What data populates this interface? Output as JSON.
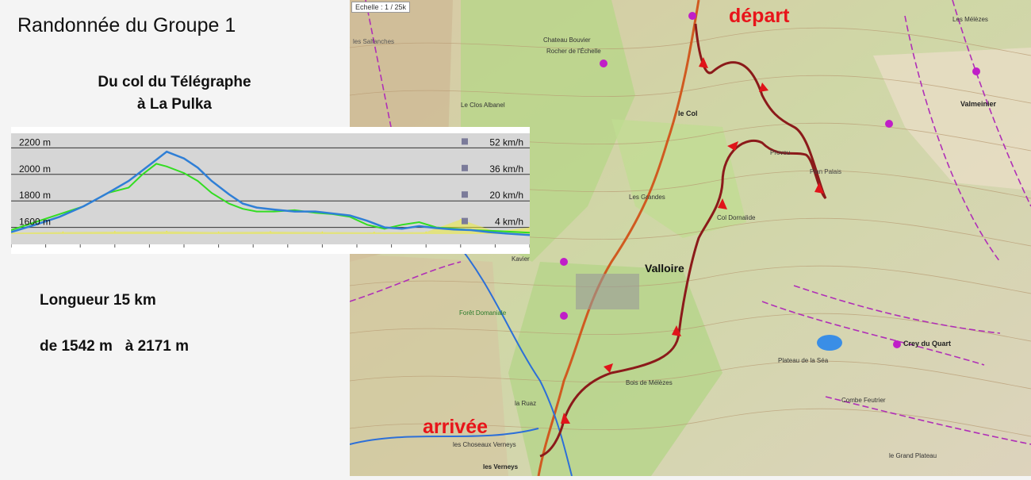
{
  "left_panel": {
    "title": "Randonnée du Groupe 1",
    "subtitle_line1": "Du col du Télégraphe",
    "subtitle_line2": "à La Pulka",
    "length": "Longueur 15 km",
    "altitude_range": "de 1542 m   à 2171 m"
  },
  "map": {
    "scale_label": "Echelle : 1 / 25k",
    "start_label": "départ",
    "end_label": "arrivée",
    "place_names": [
      "Valloire",
      "le Col",
      "Valmeinier",
      "Crey du Quart",
      "Plan Palais",
      "Provou",
      "Les Grandes",
      "Col Dornalide",
      "Bois de Mélèzes",
      "la Ruaz",
      "les Verneys",
      "les Choseaux Verneys",
      "Combe Feutrier",
      "Plateau de la Séa",
      "le Grand Plateau",
      "Les Mélèzes",
      "Forêt Domaniale",
      "Chateau Bouvier",
      "Rocher de l'Échelle",
      "les Salfanches",
      "Kavier",
      "Le Clos Albanel"
    ]
  },
  "chart_data": {
    "type": "area",
    "title": "",
    "x_unit": "km",
    "y_axis_left": {
      "label": "",
      "ticks": [
        "1600 m",
        "1800 m",
        "2000 m",
        "2200 m"
      ],
      "range": [
        1550,
        2250
      ]
    },
    "y_axis_right": {
      "label": "",
      "ticks": [
        "4 km/h",
        "20 km/h",
        "36 km/h",
        "52 km/h"
      ]
    },
    "grid": true,
    "x_range": [
      0,
      15
    ],
    "series": [
      {
        "color": "#2f7fd6",
        "x": [
          0,
          0.7,
          1.4,
          2.1,
          2.8,
          3.4,
          3.8,
          4.2,
          4.5,
          5.0,
          5.4,
          5.8,
          6.3,
          6.7,
          7.1,
          7.6,
          8.2,
          8.8,
          9.3,
          9.8,
          10.3,
          10.8,
          11.3,
          11.8,
          12.3,
          12.8,
          13.3,
          13.8,
          14.3,
          15.0
        ],
        "y": [
          1565,
          1620,
          1680,
          1760,
          1860,
          1950,
          2030,
          2110,
          2171,
          2120,
          2050,
          1950,
          1850,
          1780,
          1750,
          1735,
          1720,
          1720,
          1705,
          1690,
          1650,
          1600,
          1590,
          1610,
          1595,
          1585,
          1580,
          1565,
          1555,
          1542
        ]
      },
      {
        "color": "#33dd22",
        "x": [
          0,
          0.7,
          1.4,
          2.1,
          2.8,
          3.4,
          3.8,
          4.2,
          4.5,
          5.0,
          5.4,
          5.8,
          6.3,
          6.7,
          7.1,
          7.6,
          8.2,
          8.8,
          9.3,
          9.8,
          10.3,
          10.8,
          11.3,
          11.8,
          12.3,
          12.8,
          13.3,
          13.8,
          14.3,
          15.0
        ],
        "y": [
          1580,
          1640,
          1700,
          1760,
          1860,
          1900,
          2000,
          2080,
          2060,
          2010,
          1950,
          1860,
          1780,
          1740,
          1720,
          1720,
          1730,
          1710,
          1700,
          1680,
          1620,
          1590,
          1620,
          1640,
          1600,
          1590,
          1580,
          1575,
          1570,
          1560
        ]
      },
      {
        "color": "#ecec3a",
        "x": [
          0,
          1.5,
          3.0,
          4.5,
          6.0,
          7.5,
          9.0,
          10.5,
          12.0,
          13.0,
          14.0,
          15.0
        ],
        "y": [
          1560,
          1565,
          1568,
          1570,
          1565,
          1568,
          1565,
          1563,
          1565,
          1660,
          1570,
          1600
        ]
      }
    ]
  }
}
